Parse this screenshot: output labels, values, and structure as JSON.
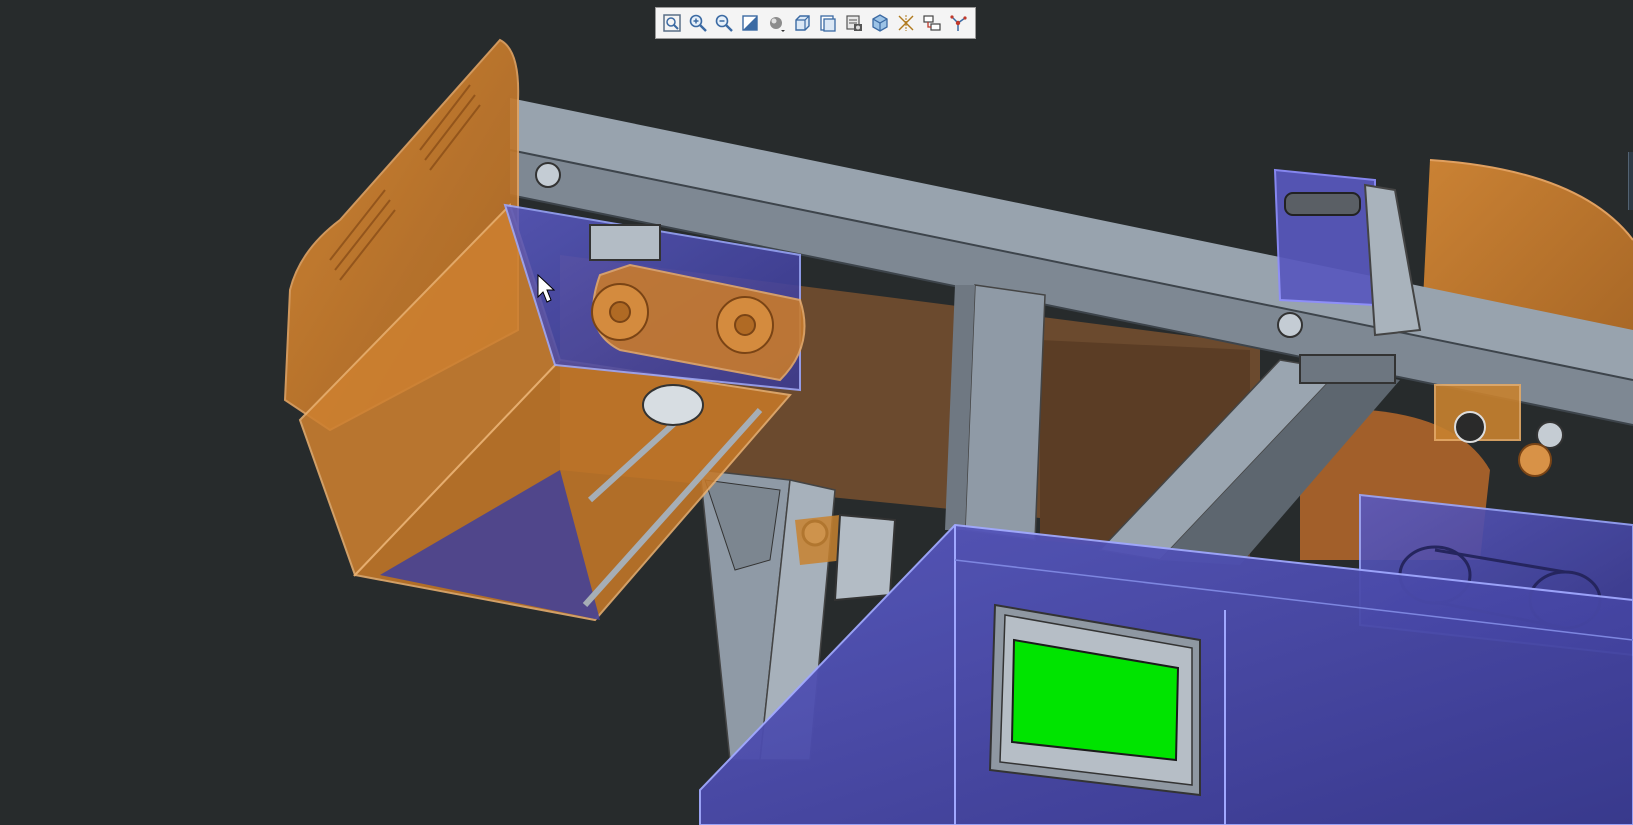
{
  "app": {
    "view": "3d-model-viewport",
    "background_color": "#272b2c"
  },
  "toolbar": {
    "buttons": [
      {
        "id": "zoom-fit",
        "icon": "zoom-fit-icon"
      },
      {
        "id": "zoom-in",
        "icon": "zoom-in-icon"
      },
      {
        "id": "zoom-out",
        "icon": "zoom-out-icon"
      },
      {
        "id": "repaint",
        "icon": "repaint-icon"
      },
      {
        "id": "display-style",
        "icon": "display-style-icon"
      },
      {
        "id": "saved-views",
        "icon": "saved-views-icon"
      },
      {
        "id": "view-manager",
        "icon": "view-manager-icon"
      },
      {
        "id": "appearance",
        "icon": "appearance-icon"
      },
      {
        "id": "section",
        "icon": "section-icon"
      },
      {
        "id": "datum-display",
        "icon": "datum-display-icon"
      },
      {
        "id": "annotation-display",
        "icon": "annotation-display-icon"
      },
      {
        "id": "spin-center",
        "icon": "spin-center-icon"
      }
    ]
  },
  "model": {
    "colors": {
      "frame": "#8f9aa6",
      "frame_dark": "#5d666f",
      "guard_orange": "#c87a2a",
      "housing_blue": "#4a4aa6",
      "display_screen": "#00e400",
      "interior_brown": "#6b4a2e"
    }
  }
}
